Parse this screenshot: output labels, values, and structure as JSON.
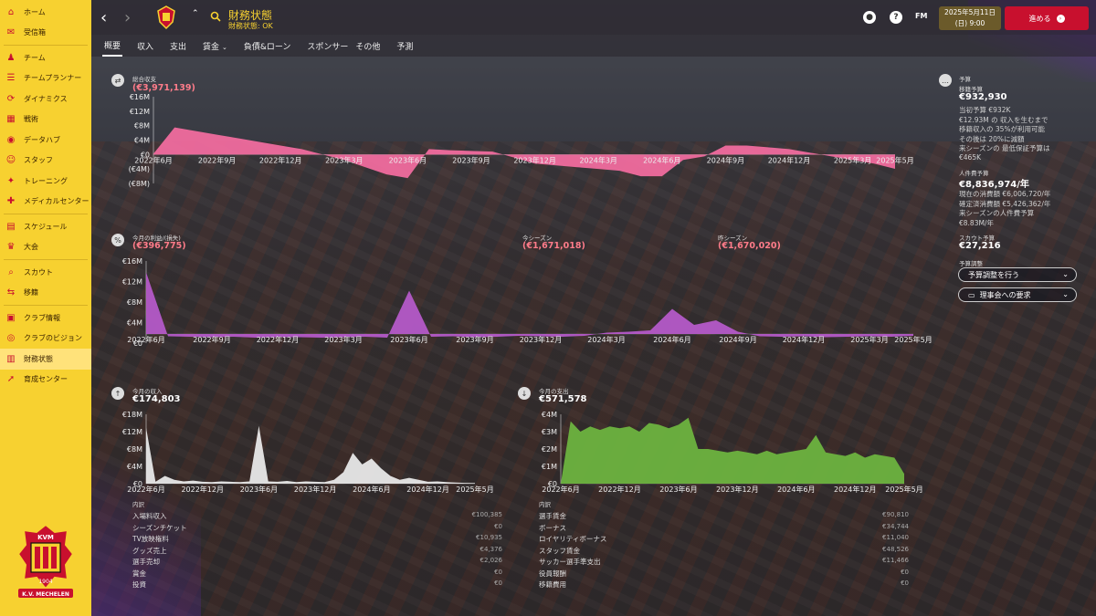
{
  "sidebar": {
    "items": [
      {
        "label": "ホーム",
        "icon": "home-icon"
      },
      {
        "label": "受信箱",
        "icon": "inbox-icon"
      },
      {
        "label": "チーム",
        "icon": "team-icon"
      },
      {
        "label": "チームプランナー",
        "icon": "planner-icon"
      },
      {
        "label": "ダイナミクス",
        "icon": "dynamics-icon"
      },
      {
        "label": "戦術",
        "icon": "tactics-icon"
      },
      {
        "label": "データハブ",
        "icon": "data-hub-icon"
      },
      {
        "label": "スタッフ",
        "icon": "staff-icon"
      },
      {
        "label": "トレーニング",
        "icon": "training-icon"
      },
      {
        "label": "メディカルセンター",
        "icon": "medical-icon"
      },
      {
        "label": "スケジュール",
        "icon": "schedule-icon"
      },
      {
        "label": "大会",
        "icon": "trophy-icon"
      },
      {
        "label": "スカウト",
        "icon": "scout-icon"
      },
      {
        "label": "移籍",
        "icon": "transfer-icon"
      },
      {
        "label": "クラブ情報",
        "icon": "club-info-icon"
      },
      {
        "label": "クラブのビジョン",
        "icon": "vision-icon"
      },
      {
        "label": "財務状態",
        "icon": "finance-icon"
      },
      {
        "label": "育成センター",
        "icon": "youth-icon"
      }
    ],
    "crest_year": "1904",
    "crest_name": "K.V. MECHELEN",
    "crest_abbr": "KVM"
  },
  "header": {
    "title": "財務状態",
    "subtitle": "財務状態: OK",
    "date_line1": "2025年5月11日",
    "date_line2": "(日) 9:00",
    "continue_label": "進める",
    "fm_label": "FM",
    "help_label": "?"
  },
  "tabs": [
    "概要",
    "収入",
    "支出",
    "賃金",
    "負債&ローン",
    "スポンサー",
    "その他",
    "予測"
  ],
  "overall": {
    "label": "総合収支",
    "value": "(€3,971,139)"
  },
  "monthly_profit": {
    "label": "今月の利益/(損失)",
    "value": "(€396,775)",
    "season_label": "今シーズン",
    "season_value": "(€1,671,018)",
    "last_season_label": "昨シーズン",
    "last_season_value": "(€1,670,020)"
  },
  "income": {
    "label": "今月の収入",
    "value": "€174,803",
    "breakdown_header": "内訳",
    "rows": [
      {
        "name": "入場料収入",
        "value": "€100,385"
      },
      {
        "name": "シーズンチケット",
        "value": "€0"
      },
      {
        "name": "TV放映権料",
        "value": "€10,935"
      },
      {
        "name": "グッズ売上",
        "value": "€4,376"
      },
      {
        "name": "選手売却",
        "value": "€2,026"
      },
      {
        "name": "賞金",
        "value": "€0"
      },
      {
        "name": "投資",
        "value": "€0"
      }
    ]
  },
  "expense": {
    "label": "今月の支出",
    "value": "€571,578",
    "breakdown_header": "内訳",
    "rows": [
      {
        "name": "選手賃金",
        "value": "€90,810"
      },
      {
        "name": "ボーナス",
        "value": "€34,744"
      },
      {
        "name": "ロイヤリティボーナス",
        "value": "€11,040"
      },
      {
        "name": "スタッフ賃金",
        "value": "€48,526"
      },
      {
        "name": "サッカー選手準支出",
        "value": "€11,466"
      },
      {
        "name": "役員報酬",
        "value": "€0"
      },
      {
        "name": "移籍費用",
        "value": "€0"
      }
    ]
  },
  "budget": {
    "section_label": "予算",
    "transfer_label": "移籍予算",
    "transfer_value": "€932,930",
    "transfer_lines": [
      "当初予算 €932K",
      "€12.93M の 収入を生むまで",
      "移籍収入の 35%が利用可能",
      "その後は 20%に減額",
      "来シーズンの 最低保証予算は",
      "€465K"
    ],
    "wage_label": "人件費予算",
    "wage_value": "€8,836,974/年",
    "wage_lines": [
      "現在の消費額 €6,006,720/年",
      "確定済消費額 €5,426,362/年",
      "来シーズンの人件費予算",
      "€8.83M/年"
    ],
    "scout_label": "スカウト予算",
    "scout_value": "€27,216",
    "adjust_label": "予算調整",
    "adjust_button": "予算調整を行う",
    "board_button": "理事会への要求"
  },
  "chart_data": [
    {
      "type": "area",
      "title": "総合収支",
      "x": [
        "2022年6月",
        "2022年7月",
        "2022年8月",
        "2022年9月",
        "2022年10月",
        "2022年11月",
        "2022年12月",
        "2023年1月",
        "2023年2月",
        "2023年3月",
        "2023年4月",
        "2023年5月",
        "2023年6月",
        "2023年7月",
        "2023年8月",
        "2023年9月",
        "2023年10月",
        "2023年11月",
        "2023年12月",
        "2024年1月",
        "2024年2月",
        "2024年3月",
        "2024年4月",
        "2024年5月",
        "2024年6月",
        "2024年7月",
        "2024年8月",
        "2024年9月",
        "2024年10月",
        "2024年11月",
        "2024年12月",
        "2025年1月",
        "2025年2月",
        "2025年3月",
        "2025年4月",
        "2025年5月"
      ],
      "values": [
        0.2,
        7.5,
        6.5,
        5.5,
        4.5,
        3.5,
        2.5,
        1.5,
        0,
        -1.5,
        -3.5,
        -5.5,
        -6.5,
        1.5,
        1.2,
        1.0,
        0.8,
        -0.8,
        -2.5,
        -3.0,
        -3.5,
        -4.0,
        -4.5,
        -6.0,
        -6.0,
        -1.5,
        -0.5,
        2.5,
        2.5,
        2.0,
        1.5,
        0.5,
        -0.5,
        -1.5,
        -2.5,
        -3.97
      ],
      "xticks": [
        "2022年6月",
        "2022年9月",
        "2022年12月",
        "2023年3月",
        "2023年6月",
        "2023年9月",
        "2023年12月",
        "2024年3月",
        "2024年6月",
        "2024年9月",
        "2024年12月",
        "2025年3月",
        "2025年5月"
      ],
      "yticks": [
        "€16M",
        "€12M",
        "€8M",
        "€4M",
        "€0",
        "(€4M)",
        "(€8M)"
      ],
      "ylim": [
        -8,
        16
      ],
      "color": "#f06b9e"
    },
    {
      "type": "area",
      "title": "今月の利益/(損失)",
      "x": [
        "2022年6月",
        "2022年7月",
        "2022年8月",
        "2022年9月",
        "2022年10月",
        "2022年11月",
        "2022年12月",
        "2023年1月",
        "2023年2月",
        "2023年3月",
        "2023年4月",
        "2023年5月",
        "2023年6月",
        "2023年7月",
        "2023年8月",
        "2023年9月",
        "2023年10月",
        "2023年11月",
        "2023年12月",
        "2024年1月",
        "2024年2月",
        "2024年3月",
        "2024年4月",
        "2024年5月",
        "2024年6月",
        "2024年7月",
        "2024年8月",
        "2024年9月",
        "2024年10月",
        "2024年11月",
        "2024年12月",
        "2025年1月",
        "2025年2月",
        "2025年3月",
        "2025年4月",
        "2025年5月"
      ],
      "values": [
        13.5,
        -0.5,
        -0.6,
        -0.7,
        -0.6,
        -0.8,
        -0.7,
        -0.7,
        -0.8,
        -0.7,
        -0.6,
        -0.8,
        9.5,
        -0.6,
        -0.5,
        -0.7,
        -0.6,
        -0.4,
        -0.5,
        -0.6,
        -0.4,
        0.3,
        0.5,
        0.8,
        5.5,
        2.0,
        3.0,
        0.5,
        -0.5,
        -0.6,
        -0.5,
        -0.7,
        -0.6,
        -0.5,
        -0.6,
        -0.4
      ],
      "xticks": [
        "2022年6月",
        "2022年9月",
        "2022年12月",
        "2023年3月",
        "2023年6月",
        "2023年9月",
        "2023年12月",
        "2024年3月",
        "2024年6月",
        "2024年9月",
        "2024年12月",
        "2025年3月",
        "2025年5月"
      ],
      "yticks": [
        "€16M",
        "€12M",
        "€8M",
        "€4M",
        "€0"
      ],
      "ylim": [
        -2,
        16
      ],
      "color": "#b45ac8"
    },
    {
      "type": "area",
      "title": "今月の収入",
      "x": [
        "2022年6月",
        "2022年7月",
        "2022年8月",
        "2022年9月",
        "2022年10月",
        "2022年11月",
        "2022年12月",
        "2023年1月",
        "2023年2月",
        "2023年3月",
        "2023年4月",
        "2023年5月",
        "2023年6月",
        "2023年7月",
        "2023年8月",
        "2023年9月",
        "2023年10月",
        "2023年11月",
        "2023年12月",
        "2024年1月",
        "2024年2月",
        "2024年3月",
        "2024年4月",
        "2024年5月",
        "2024年6月",
        "2024年7月",
        "2024年8月",
        "2024年9月",
        "2024年10月",
        "2024年11月",
        "2024年12月",
        "2025年1月",
        "2025年2月",
        "2025年3月",
        "2025年4月",
        "2025年5月"
      ],
      "values": [
        14.5,
        0.5,
        2.0,
        1.0,
        0.6,
        0.8,
        0.5,
        0.4,
        0.6,
        0.5,
        0.4,
        0.6,
        15.0,
        0.6,
        0.5,
        0.7,
        0.4,
        0.6,
        0.5,
        0.4,
        1.0,
        3.0,
        8.0,
        5.0,
        6.5,
        4.0,
        2.0,
        1.0,
        1.5,
        1.0,
        0.5,
        0.6,
        0.4,
        0.3,
        0.2,
        0.17
      ],
      "xticks": [
        "2022年6月",
        "2022年12月",
        "2023年6月",
        "2023年12月",
        "2024年6月",
        "2024年12月",
        "2025年5月"
      ],
      "yticks": [
        "€18M",
        "€12M",
        "€8M",
        "€4M",
        "€0"
      ],
      "ylim": [
        0,
        18
      ],
      "color": "#e8e8e8"
    },
    {
      "type": "area",
      "title": "今月の支出",
      "x": [
        "2022年6月",
        "2022年7月",
        "2022年8月",
        "2022年9月",
        "2022年10月",
        "2022年11月",
        "2022年12月",
        "2023年1月",
        "2023年2月",
        "2023年3月",
        "2023年4月",
        "2023年5月",
        "2023年6月",
        "2023年7月",
        "2023年8月",
        "2023年9月",
        "2023年10月",
        "2023年11月",
        "2023年12月",
        "2024年1月",
        "2024年2月",
        "2024年3月",
        "2024年4月",
        "2024年5月",
        "2024年6月",
        "2024年7月",
        "2024年8月",
        "2024年9月",
        "2024年10月",
        "2024年11月",
        "2024年12月",
        "2025年1月",
        "2025年2月",
        "2025年3月",
        "2025年4月",
        "2025年5月"
      ],
      "values": [
        0.0,
        3.6,
        3.0,
        3.3,
        3.1,
        3.3,
        3.2,
        3.3,
        3.0,
        3.5,
        3.4,
        3.2,
        3.4,
        3.8,
        2.0,
        2.0,
        1.9,
        1.8,
        1.9,
        1.8,
        1.7,
        1.9,
        1.7,
        1.8,
        1.9,
        2.0,
        2.8,
        1.8,
        1.7,
        1.6,
        1.8,
        1.5,
        1.7,
        1.6,
        1.5,
        0.57
      ],
      "xticks": [
        "2022年6月",
        "2022年12月",
        "2023年6月",
        "2023年12月",
        "2024年6月",
        "2024年12月",
        "2025年5月"
      ],
      "yticks": [
        "€4M",
        "€3M",
        "€2M",
        "€1M",
        "€0"
      ],
      "ylim": [
        0,
        4
      ],
      "color": "#6db33f"
    }
  ]
}
